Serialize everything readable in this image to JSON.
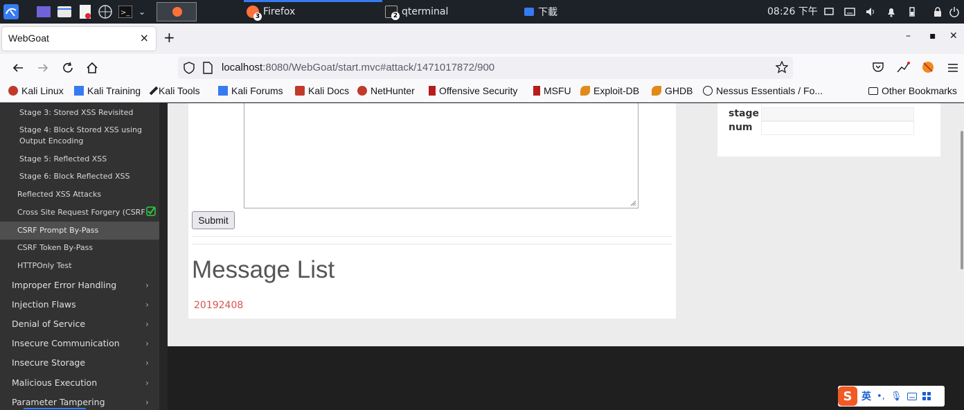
{
  "taskbar": {
    "tasks": [
      {
        "label": "Firefox",
        "badge": "3"
      },
      {
        "label": "qterminal",
        "badge": "2"
      },
      {
        "label": "下載"
      }
    ],
    "clock": "08:26 下午"
  },
  "browser": {
    "tab_title": "WebGoat",
    "tab_close": "×",
    "new_tab": "+",
    "url_host": "localhost",
    "url_path": ":8080/WebGoat/start.mvc#attack/1471017872/900",
    "window_controls": {
      "minimize": "–",
      "maximize": "▪",
      "close": "✕"
    }
  },
  "bookmarks": [
    "Kali Linux",
    "Kali Training",
    "Kali Tools",
    "Kali Forums",
    "Kali Docs",
    "NetHunter",
    "Offensive Security",
    "MSFU",
    "Exploit-DB",
    "GHDB",
    "Nessus Essentials / Fo...",
    "Other Bookmarks"
  ],
  "sidebar": {
    "stages": [
      "Stage 3: Stored XSS Revisited",
      "Stage 4: Block Stored XSS using Output Encoding",
      "Stage 5: Reflected XSS",
      "Stage 6: Block Reflected XSS"
    ],
    "lessons": [
      "Reflected XSS Attacks",
      "Cross Site Request Forgery (CSRF",
      "CSRF Prompt By-Pass",
      "CSRF Token By-Pass",
      "HTTPOnly Test"
    ],
    "categories": [
      "Improper Error Handling",
      "Injection Flaws",
      "Denial of Service",
      "Insecure Communication",
      "Insecure Storage",
      "Malicious Execution",
      "Parameter Tampering"
    ],
    "arrow": "›"
  },
  "main": {
    "submit_label": "Submit",
    "message_list_title": "Message List",
    "messages": [
      "20192408"
    ]
  },
  "params": {
    "labels": [
      "stage",
      "num"
    ]
  },
  "ime": {
    "logo": "S",
    "mode": "英"
  }
}
